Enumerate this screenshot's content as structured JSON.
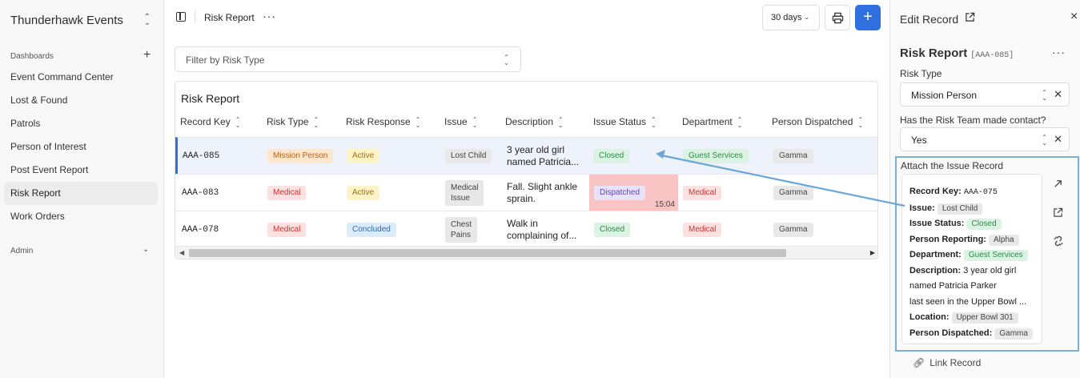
{
  "sidebar": {
    "brand": "Thunderhawk Events",
    "section_title": "Dashboards",
    "items": [
      {
        "label": "Event Command Center"
      },
      {
        "label": "Lost & Found"
      },
      {
        "label": "Patrols"
      },
      {
        "label": "Person of Interest"
      },
      {
        "label": "Post Event Report"
      },
      {
        "label": "Risk Report"
      },
      {
        "label": "Work Orders"
      }
    ],
    "active_item": "Risk Report",
    "admin": "Admin"
  },
  "topbar": {
    "title": "Risk Report",
    "range": "30 days",
    "add_label": "+"
  },
  "filter": {
    "placeholder": "Filter by Risk Type"
  },
  "table": {
    "title": "Risk Report",
    "columns": [
      "Record Key",
      "Risk Type",
      "Risk Response",
      "Issue",
      "Description",
      "Issue Status",
      "Department",
      "Person Dispatched"
    ],
    "rows": [
      {
        "key": "AAA-085",
        "risk_type": "Mission Person",
        "response": "Active",
        "issue": "Lost Child",
        "desc1": "3 year old girl",
        "desc2": "named Patricia...",
        "status": "Closed",
        "department": "Guest Services",
        "dispatched": "Gamma"
      },
      {
        "key": "AAA-083",
        "risk_type": "Medical",
        "response": "Active",
        "issue1": "Medical",
        "issue2": "Issue",
        "desc1": "Fall. Slight ankle",
        "desc2": "sprain.",
        "status": "Dispatched",
        "status_time": "15:04",
        "department": "Medical",
        "dispatched": "Gamma"
      },
      {
        "key": "AAA-078",
        "risk_type": "Medical",
        "response": "Concluded",
        "issue1": "Chest",
        "issue2": "Pains",
        "desc1": "Walk in",
        "desc2": "complaining of...",
        "status": "Closed",
        "department": "Medical",
        "dispatched": "Gamma"
      }
    ]
  },
  "panel": {
    "title": "Edit Record",
    "record_title": "Risk Report",
    "record_key": "[AAA-085]",
    "risk_type_label": "Risk Type",
    "risk_type_value": "Mission Person",
    "contact_label": "Has the Risk Team made contact?",
    "contact_value": "Yes",
    "attach_label": "Attach the Issue Record",
    "attached": {
      "record_key_label": "Record Key:",
      "record_key": "AAA-075",
      "issue_label": "Issue:",
      "issue": "Lost Child",
      "status_label": "Issue Status:",
      "status": "Closed",
      "reporting_label": "Person Reporting:",
      "reporting": "Alpha",
      "department_label": "Department:",
      "department": "Guest Services",
      "description_label": "Description:",
      "description1": "3 year old girl",
      "description2": "named Patricia Parker",
      "description3": "last seen in the Upper Bowl ...",
      "location_label": "Location:",
      "location": "Upper Bowl 301",
      "dispatched_label": "Person Dispatched:",
      "dispatched": "Gamma"
    },
    "link_record": "Link Record"
  },
  "colors": {
    "accent": "#2f6fe0",
    "highlight_border": "#7aaedb",
    "dispatched_bg": "#f9c4c4"
  },
  "icons": [
    "sidebar-toggle-icon",
    "more-icon",
    "print-icon",
    "plus-icon",
    "chevron-updown-icon",
    "external-link-icon",
    "close-icon",
    "expand-icon",
    "unlink-icon",
    "link-icon"
  ]
}
